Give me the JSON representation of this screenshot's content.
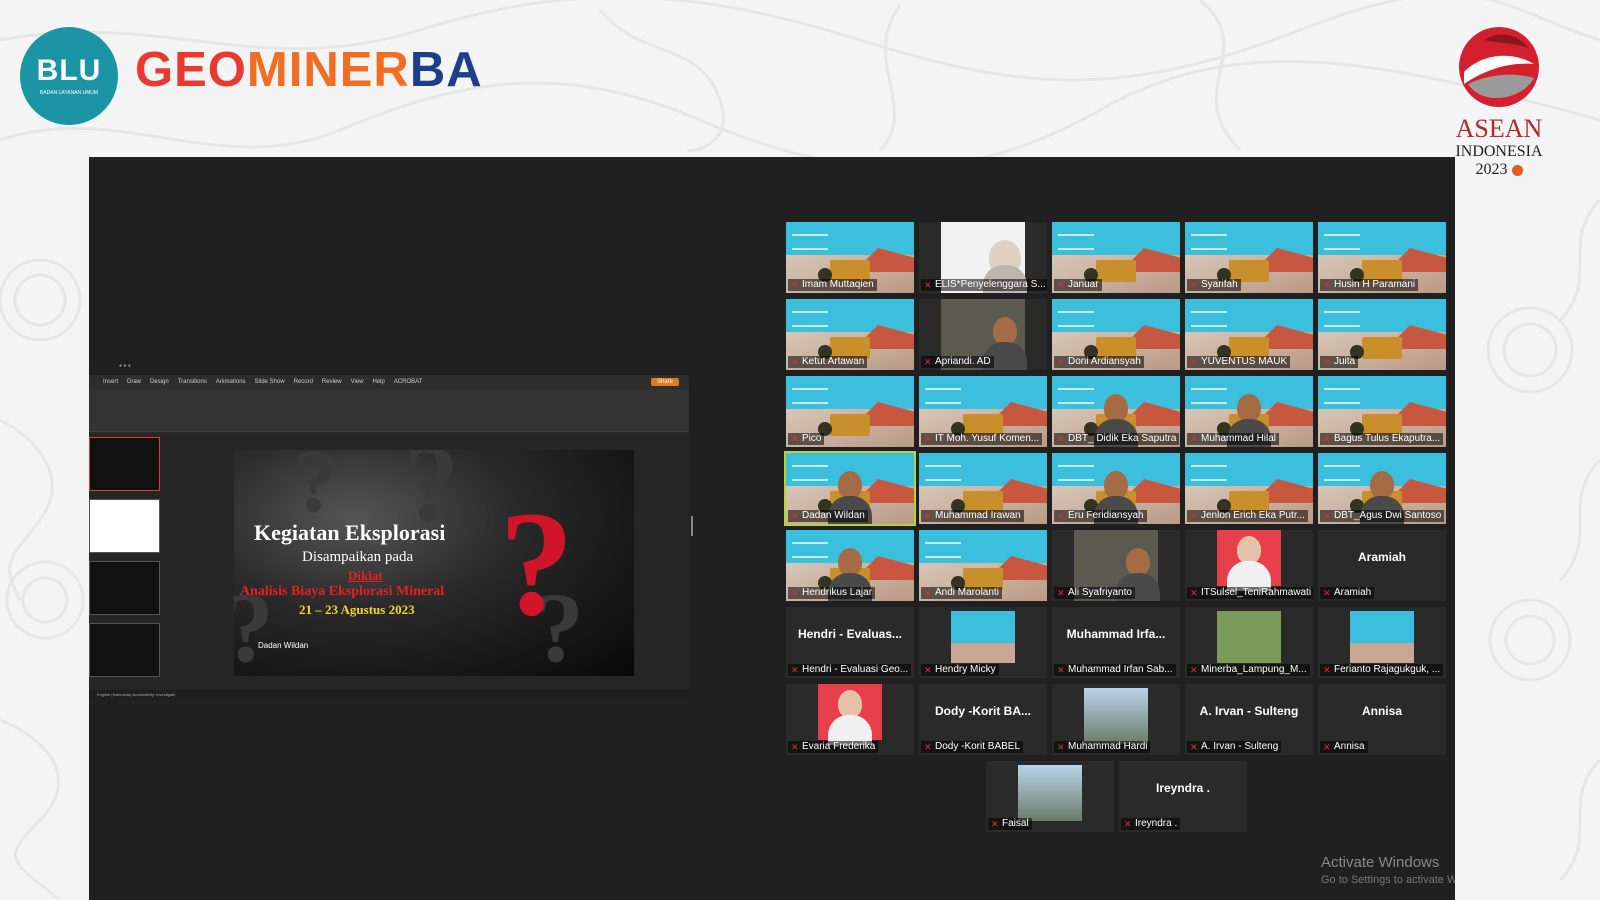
{
  "header": {
    "blu_logo": {
      "main": "BLU",
      "sub": "BADAN LAYANAN UMUM"
    },
    "brand": {
      "part1": "GEO",
      "part2": "MINER",
      "part3": "BA"
    },
    "asean": {
      "name": "ASEAN",
      "host": "INDONESIA",
      "year": "2023"
    }
  },
  "powerpoint": {
    "menu": [
      "Insert",
      "Draw",
      "Design",
      "Transitions",
      "Animations",
      "Slide Show",
      "Record",
      "Review",
      "View",
      "Help",
      "ACROBAT"
    ],
    "share_label": "Share",
    "statusbar": "English (Indonesia)   Accessibility: Investigate",
    "slide": {
      "title": "Kegiatan Eksplorasi",
      "presented_at": "Disampaikan pada",
      "event": "Diklat",
      "course": "Analisis Biaya Eksplorasi Mineral",
      "date": "21 – 23 Agustus 2023",
      "presenter": "Dadan Wildan"
    }
  },
  "participants": [
    {
      "name": "Imam Muttaqien",
      "view": "slide"
    },
    {
      "name": "ELIS*Penyelenggara S...",
      "view": "hijab"
    },
    {
      "name": "Januar",
      "view": "slide"
    },
    {
      "name": "Syarifah",
      "view": "slide"
    },
    {
      "name": "Husin H Paramani",
      "view": "slide"
    },
    {
      "name": "Ketut Artawan",
      "view": "slide"
    },
    {
      "name": "Apriandi. AD",
      "view": "person"
    },
    {
      "name": "Doni Ardiansyah",
      "view": "slide"
    },
    {
      "name": "YUVENTUS MAUK",
      "view": "slide"
    },
    {
      "name": "Juita",
      "view": "slide"
    },
    {
      "name": "Pico",
      "view": "slide"
    },
    {
      "name": "IT Moh. Yusuf Komen...",
      "view": "slide"
    },
    {
      "name": "DBT_ Didik Eka Saputra",
      "view": "slideperson"
    },
    {
      "name": "Muhammad Hilal",
      "view": "slideperson"
    },
    {
      "name": "Bagus Tulus Ekaputra...",
      "view": "slide"
    },
    {
      "name": "Dadan Wildan",
      "view": "slideperson",
      "active": true
    },
    {
      "name": "Muhammad Irawan",
      "view": "slide"
    },
    {
      "name": "Eru Feridiansyah",
      "view": "slideperson"
    },
    {
      "name": "Jenlon Erich Eka Putr...",
      "view": "slide"
    },
    {
      "name": "DBT_Agus Dwi Santoso",
      "view": "slideperson"
    },
    {
      "name": "Hendrikus Lajar",
      "view": "slideperson"
    },
    {
      "name": "Andi Marolanti",
      "view": "slide"
    },
    {
      "name": "Ali Syafriyanto",
      "view": "person"
    },
    {
      "name": "ITSulsel_TeniRahmawati",
      "view": "photo"
    },
    {
      "name": "Aramiah",
      "view": "text",
      "display": "Aramiah"
    },
    {
      "name": "Hendri - Evaluasi Geo...",
      "view": "text",
      "display": "Hendri - Evaluas..."
    },
    {
      "name": "Hendry Micky",
      "view": "smallslide"
    },
    {
      "name": "Muhammad Irfan Sab...",
      "view": "text",
      "display": "Muhammad Irfa..."
    },
    {
      "name": "Minerba_Lampung_M...",
      "view": "smallmap"
    },
    {
      "name": "Ferianto Rajagukguk, ...",
      "view": "smallslide"
    },
    {
      "name": "Evaria Frederika",
      "view": "photo"
    },
    {
      "name": "Dody -Korit BABEL",
      "view": "text",
      "display": "Dody -Korit BA..."
    },
    {
      "name": "Muhammad Hardi",
      "view": "photo2"
    },
    {
      "name": "A. Irvan - Sulteng",
      "view": "text",
      "display": "A. Irvan - Sulteng"
    },
    {
      "name": "Annisa",
      "view": "text",
      "display": "Annisa"
    },
    {
      "name": "Faisal",
      "view": "photo2"
    },
    {
      "name": "Ireyndra .",
      "view": "text",
      "display": "Ireyndra ."
    }
  ],
  "watermark": {
    "title": "Activate Windows",
    "sub": "Go to Settings to activate Windows."
  },
  "colors": {
    "brand_red": "#e83a30",
    "brand_orange": "#f06d22",
    "brand_blue": "#1c3f8c",
    "active_speaker": "#b8d62a"
  }
}
